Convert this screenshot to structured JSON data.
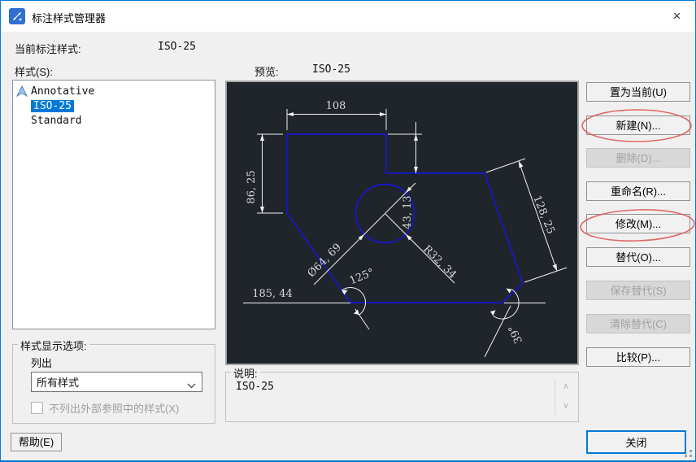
{
  "window": {
    "title": "标注样式管理器",
    "close_glyph": "×"
  },
  "header": {
    "current_label": "当前标注样式:",
    "current_value": "ISO-25"
  },
  "styles": {
    "label": "样式(S):",
    "items": [
      {
        "label": "Annotative"
      },
      {
        "label": "ISO-25"
      },
      {
        "label": "Standard"
      }
    ],
    "selected": "ISO-25"
  },
  "preview": {
    "label": "预览:",
    "value": "ISO-25",
    "dimensions": {
      "top_width": "108",
      "left_height": "86, 25",
      "notch_height": "43, 13",
      "right_length": "128, 25",
      "diameter": "Ø64, 69",
      "radius": "R32, 34",
      "angle_left": "125°",
      "bottom_left": "185, 44",
      "angle_right": "39°"
    }
  },
  "actions": [
    {
      "label": "置为当前(U)",
      "enabled": true,
      "circled": false
    },
    {
      "label": "新建(N)...",
      "enabled": true,
      "circled": true
    },
    {
      "label": "删除(D)...",
      "enabled": false,
      "circled": false
    },
    {
      "label": "重命名(R)...",
      "enabled": true,
      "circled": false
    },
    {
      "label": "修改(M)...",
      "enabled": true,
      "circled": true
    },
    {
      "label": "替代(O)...",
      "enabled": true,
      "circled": false
    },
    {
      "label": "保存替代(S)",
      "enabled": false,
      "circled": false
    },
    {
      "label": "清除替代(C)",
      "enabled": false,
      "circled": false
    },
    {
      "label": "比较(P)...",
      "enabled": true,
      "circled": false
    }
  ],
  "display_options": {
    "group_label": "样式显示选项:",
    "list_label": "列出",
    "filter_value": "所有样式",
    "xref_checkbox_label": "不列出外部参照中的样式(X)",
    "xref_checked": false
  },
  "description": {
    "group_label": "说明:",
    "text": "ISO-25"
  },
  "footer": {
    "help_label": "帮助(E)",
    "close_label": "关闭"
  },
  "colors": {
    "accent": "#0078d7",
    "selection": "#0078d7",
    "preview_background": "#20242b",
    "cad_line": "#1414f0",
    "dimension_line": "#f2f2f2",
    "annotation_red": "#e05a5a"
  }
}
